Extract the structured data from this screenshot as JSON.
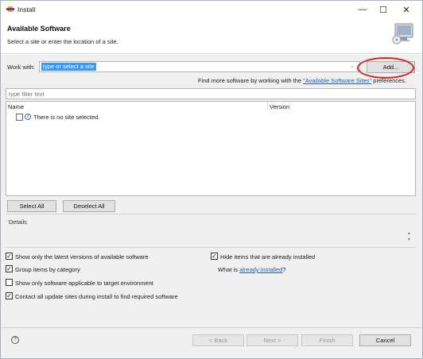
{
  "window": {
    "title": "Install",
    "minimize_glyph": "—",
    "maximize_glyph": "☐",
    "close_glyph": "✕"
  },
  "header": {
    "title": "Available Software",
    "subtitle": "Select a site or enter the location of a site."
  },
  "work_with": {
    "label": "Work with:",
    "value": "type or select a site",
    "add_button": "Add...",
    "highlight_color": "#d9241b"
  },
  "find_more": {
    "prefix": "Find more software by working with the ",
    "link": "\"Available Software Sites\"",
    "suffix": " preferences."
  },
  "filter": {
    "placeholder": "type filter text"
  },
  "tree": {
    "columns": [
      "Name",
      "Version"
    ],
    "message": "There is no site selected.",
    "info_glyph": "i"
  },
  "selection_buttons": {
    "select_all": "Select All",
    "deselect_all": "Deselect All"
  },
  "details": {
    "label": "Details"
  },
  "options": {
    "latest_versions": {
      "label": "Show only the latest versions of available software",
      "checked": true
    },
    "group_by_category": {
      "label": "Group items by category",
      "checked": true
    },
    "target_env": {
      "label": "Show only software applicable to target environment",
      "checked": false
    },
    "contact_sites": {
      "label": "Contact all update sites during install to find required software",
      "checked": true
    },
    "hide_installed": {
      "label": "Hide items that are already installed",
      "checked": true
    },
    "what_is": {
      "prefix": "What is ",
      "link": "already installed",
      "suffix": "?"
    }
  },
  "footer": {
    "help_glyph": "?",
    "back": "< Back",
    "next": "Next >",
    "finish": "Finish",
    "cancel": "Cancel"
  }
}
